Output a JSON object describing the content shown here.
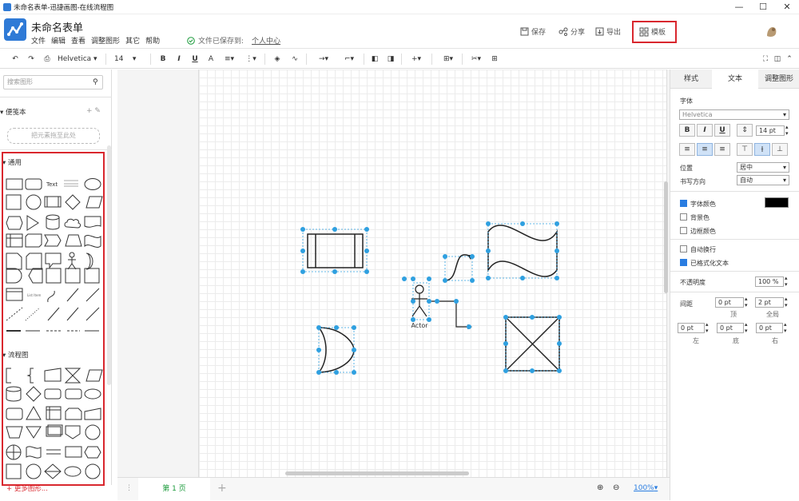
{
  "window": {
    "title": "未命名表单-迅捷画图-在线流程图",
    "controls": [
      "—",
      "☐",
      "✕"
    ]
  },
  "header": {
    "doc_title": "未命名表单",
    "menu": [
      "文件",
      "编辑",
      "查看",
      "调整图形",
      "其它",
      "帮助"
    ],
    "save_status": "文件已保存到:",
    "save_location": "个人中心",
    "actions": {
      "save": "保存",
      "share": "分享",
      "export": "导出",
      "template": "模板"
    }
  },
  "toolbar": {
    "font": "Helvetica",
    "font_size": "14",
    "bold": "B",
    "italic": "I",
    "underline": "U",
    "font_color": "A"
  },
  "left_panel": {
    "search_placeholder": "搜索图形",
    "scratchpad_title": "便笺本",
    "scratchpad_actions": "+ ✎",
    "dropzone_text": "把元素拖至此处",
    "general_title": "通用",
    "general_text_item": "Text",
    "general_list_item": "List Item",
    "flowchart_title": "流程图",
    "more_shapes": "+ 更多图形..."
  },
  "canvas": {
    "actor_label": "Actor"
  },
  "bottom_bar": {
    "page_tab": "第 1 页",
    "add_page": "+",
    "zoom": "100%"
  },
  "right_panel": {
    "tabs": [
      "样式",
      "文本",
      "调整图形"
    ],
    "active_tab": "文本",
    "font_label": "字体",
    "font_value": "Helvetica",
    "bold": "B",
    "italic": "I",
    "underline": "U",
    "font_size_value": "14 pt",
    "position_label": "位置",
    "position_value": "居中",
    "direction_label": "书写方向",
    "direction_value": "自动",
    "font_color_label": "字体颜色",
    "bg_color_label": "背景色",
    "border_color_label": "边框颜色",
    "wrap_label": "自动换行",
    "formatted_label": "已格式化文本",
    "opacity_label": "不透明度",
    "opacity_value": "100 %",
    "spacing_label": "间距",
    "spacing_top_value": "0 pt",
    "spacing_global_value": "2 pt",
    "spacing_top_label": "顶",
    "spacing_global_label": "全局",
    "spacing_left_value": "0 pt",
    "spacing_bottom_value": "0 pt",
    "spacing_right_value": "0 pt",
    "spacing_left_label": "左",
    "spacing_bottom_label": "底",
    "spacing_right_label": "右",
    "font_color_swatch": "#000000"
  },
  "colors": {
    "accent": "#2a7de1",
    "highlight": "#d9272e",
    "selection": "#2fa0e0",
    "page_tab_text": "#1a9a3a"
  }
}
